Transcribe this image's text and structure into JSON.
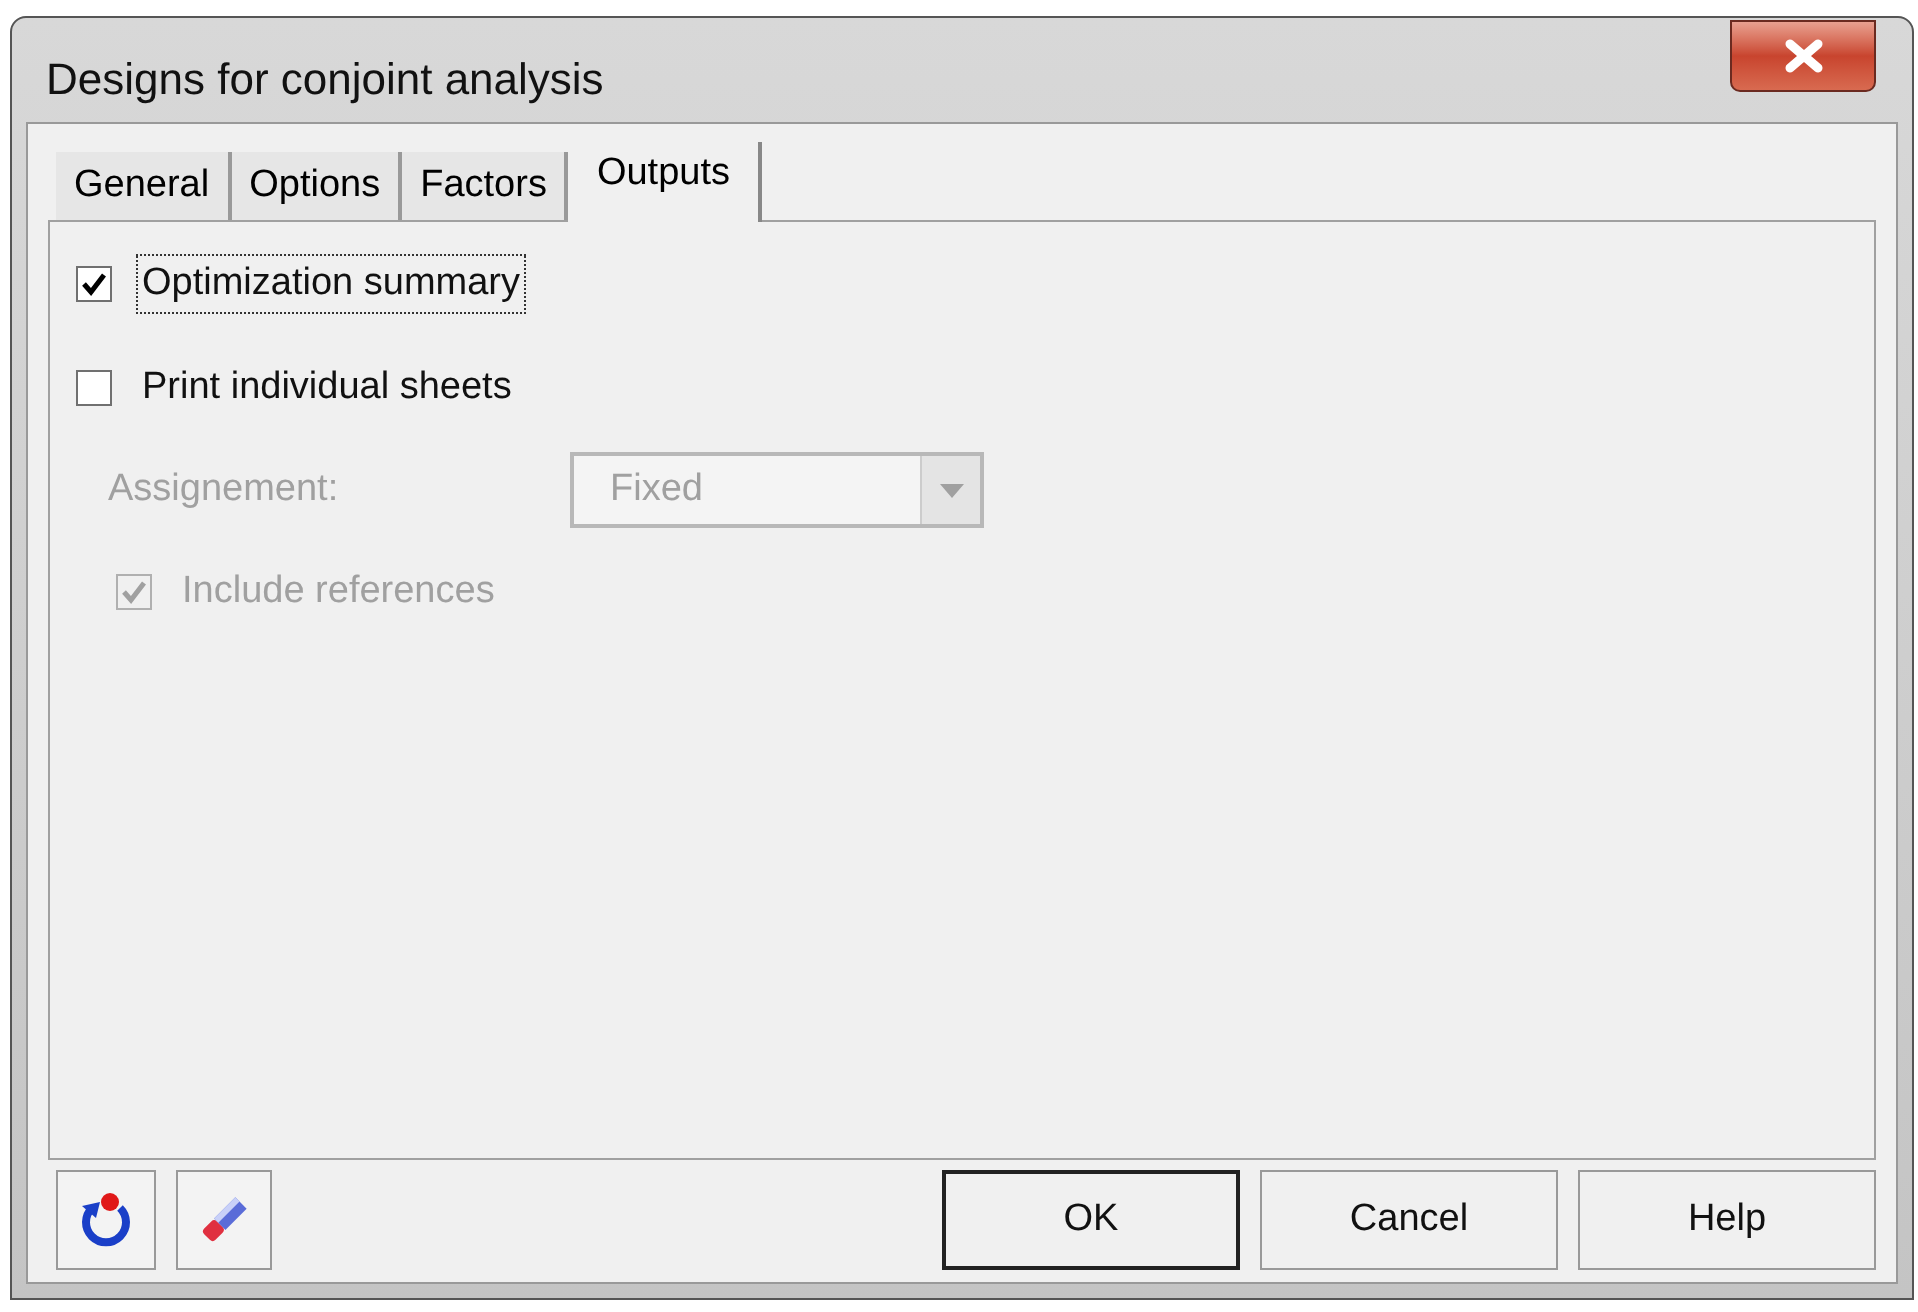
{
  "window": {
    "title": "Designs for conjoint analysis"
  },
  "tabs": [
    {
      "label": "General",
      "selected": false
    },
    {
      "label": "Options",
      "selected": false
    },
    {
      "label": "Factors",
      "selected": false
    },
    {
      "label": "Outputs",
      "selected": true
    }
  ],
  "outputs": [
    {
      "kind": "checkbox",
      "label": "Optimization summary",
      "checked": true,
      "disabled": false,
      "focused": true
    },
    {
      "kind": "checkbox",
      "label": "Print individual sheets",
      "checked": false,
      "disabled": false,
      "focused": false
    },
    {
      "kind": "dropdown",
      "label": "Assignement:",
      "value": "Fixed",
      "disabled": true
    },
    {
      "kind": "checkbox",
      "label": "Include references",
      "checked": true,
      "disabled": true,
      "focused": false,
      "indent": true
    }
  ],
  "buttons": [
    {
      "label": "OK",
      "default": true
    },
    {
      "label": "Cancel",
      "default": false
    },
    {
      "label": "Help",
      "default": false
    }
  ]
}
